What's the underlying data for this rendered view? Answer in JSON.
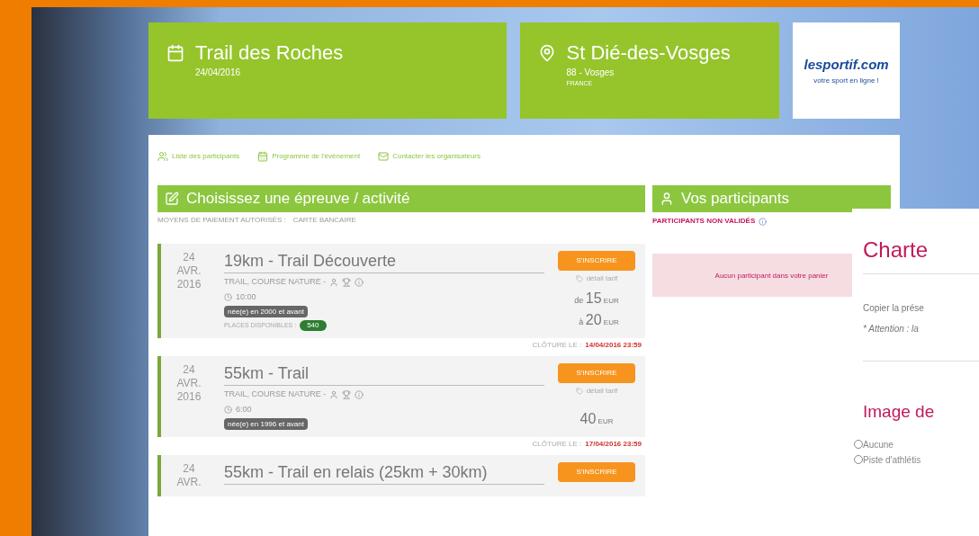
{
  "event": {
    "title": "Trail des Roches",
    "date": "24/04/2016"
  },
  "location": {
    "city": "St Dié-des-Vosges",
    "department": "88 - Vosges",
    "country": "FRANCE"
  },
  "sponsor": {
    "logo_text": "lesportif.com",
    "tagline": "votre sport en ligne !"
  },
  "links": [
    {
      "kind": "users",
      "label": "Liste des participants"
    },
    {
      "kind": "calendar",
      "label": "Programme de l'événement"
    },
    {
      "kind": "mail",
      "label": "Contacter les organisateurs"
    }
  ],
  "activities": {
    "title": "Choisissez une épreuve / activité",
    "payment": "MOYENS DE PAIEMENT AUTORISÉS :",
    "payment_value": "CARTE BANCAIRE",
    "rows": [
      {
        "day": "24",
        "month": "AVR.",
        "year": "2016",
        "title": "19km - Trail Découverte",
        "tags": "TRAIL, COURSE NATURE -",
        "time": "10:00",
        "age": "née(e) en 2000 et avant",
        "places_label": "PLACES DISPONIBLES :",
        "places": "540",
        "button": "S'INSCRIRE",
        "tarif": "détail tarif",
        "prices": [
          {
            "prefix": "de",
            "amount": "15",
            "currency": "EUR"
          },
          {
            "prefix": "à",
            "amount": "20",
            "currency": "EUR"
          }
        ],
        "closing_label": "CLÔTURE LE :",
        "closing": "14/04/2016 23:59"
      },
      {
        "day": "24",
        "month": "AVR.",
        "year": "2016",
        "title": "55km - Trail",
        "tags": "TRAIL, COURSE NATURE -",
        "time": "6:00",
        "age": "née(e) en 1996 et avant",
        "button": "S'INSCRIRE",
        "tarif": "détail tarif",
        "prices": [
          {
            "amount": "40",
            "currency": "EUR"
          }
        ],
        "closing_label": "CLÔTURE LE :",
        "closing": "17/04/2016 23:59"
      },
      {
        "day": "24",
        "month": "AVR.",
        "title": "55km - Trail en relais (25km + 30km)",
        "button": "S'INSCRIRE"
      }
    ]
  },
  "participants": {
    "title": "Vos participants",
    "warning": "PARTICIPANTS NON VALIDÉS",
    "empty": "Aucun participant dans votre panier"
  },
  "charter": {
    "title": "Charte",
    "text": "Copier la prése",
    "note": "* Attention : la",
    "image_title": "Image de",
    "options": [
      {
        "label": "Aucune",
        "selected": false
      },
      {
        "label": "Piste d'athlétis",
        "selected": false
      }
    ]
  }
}
